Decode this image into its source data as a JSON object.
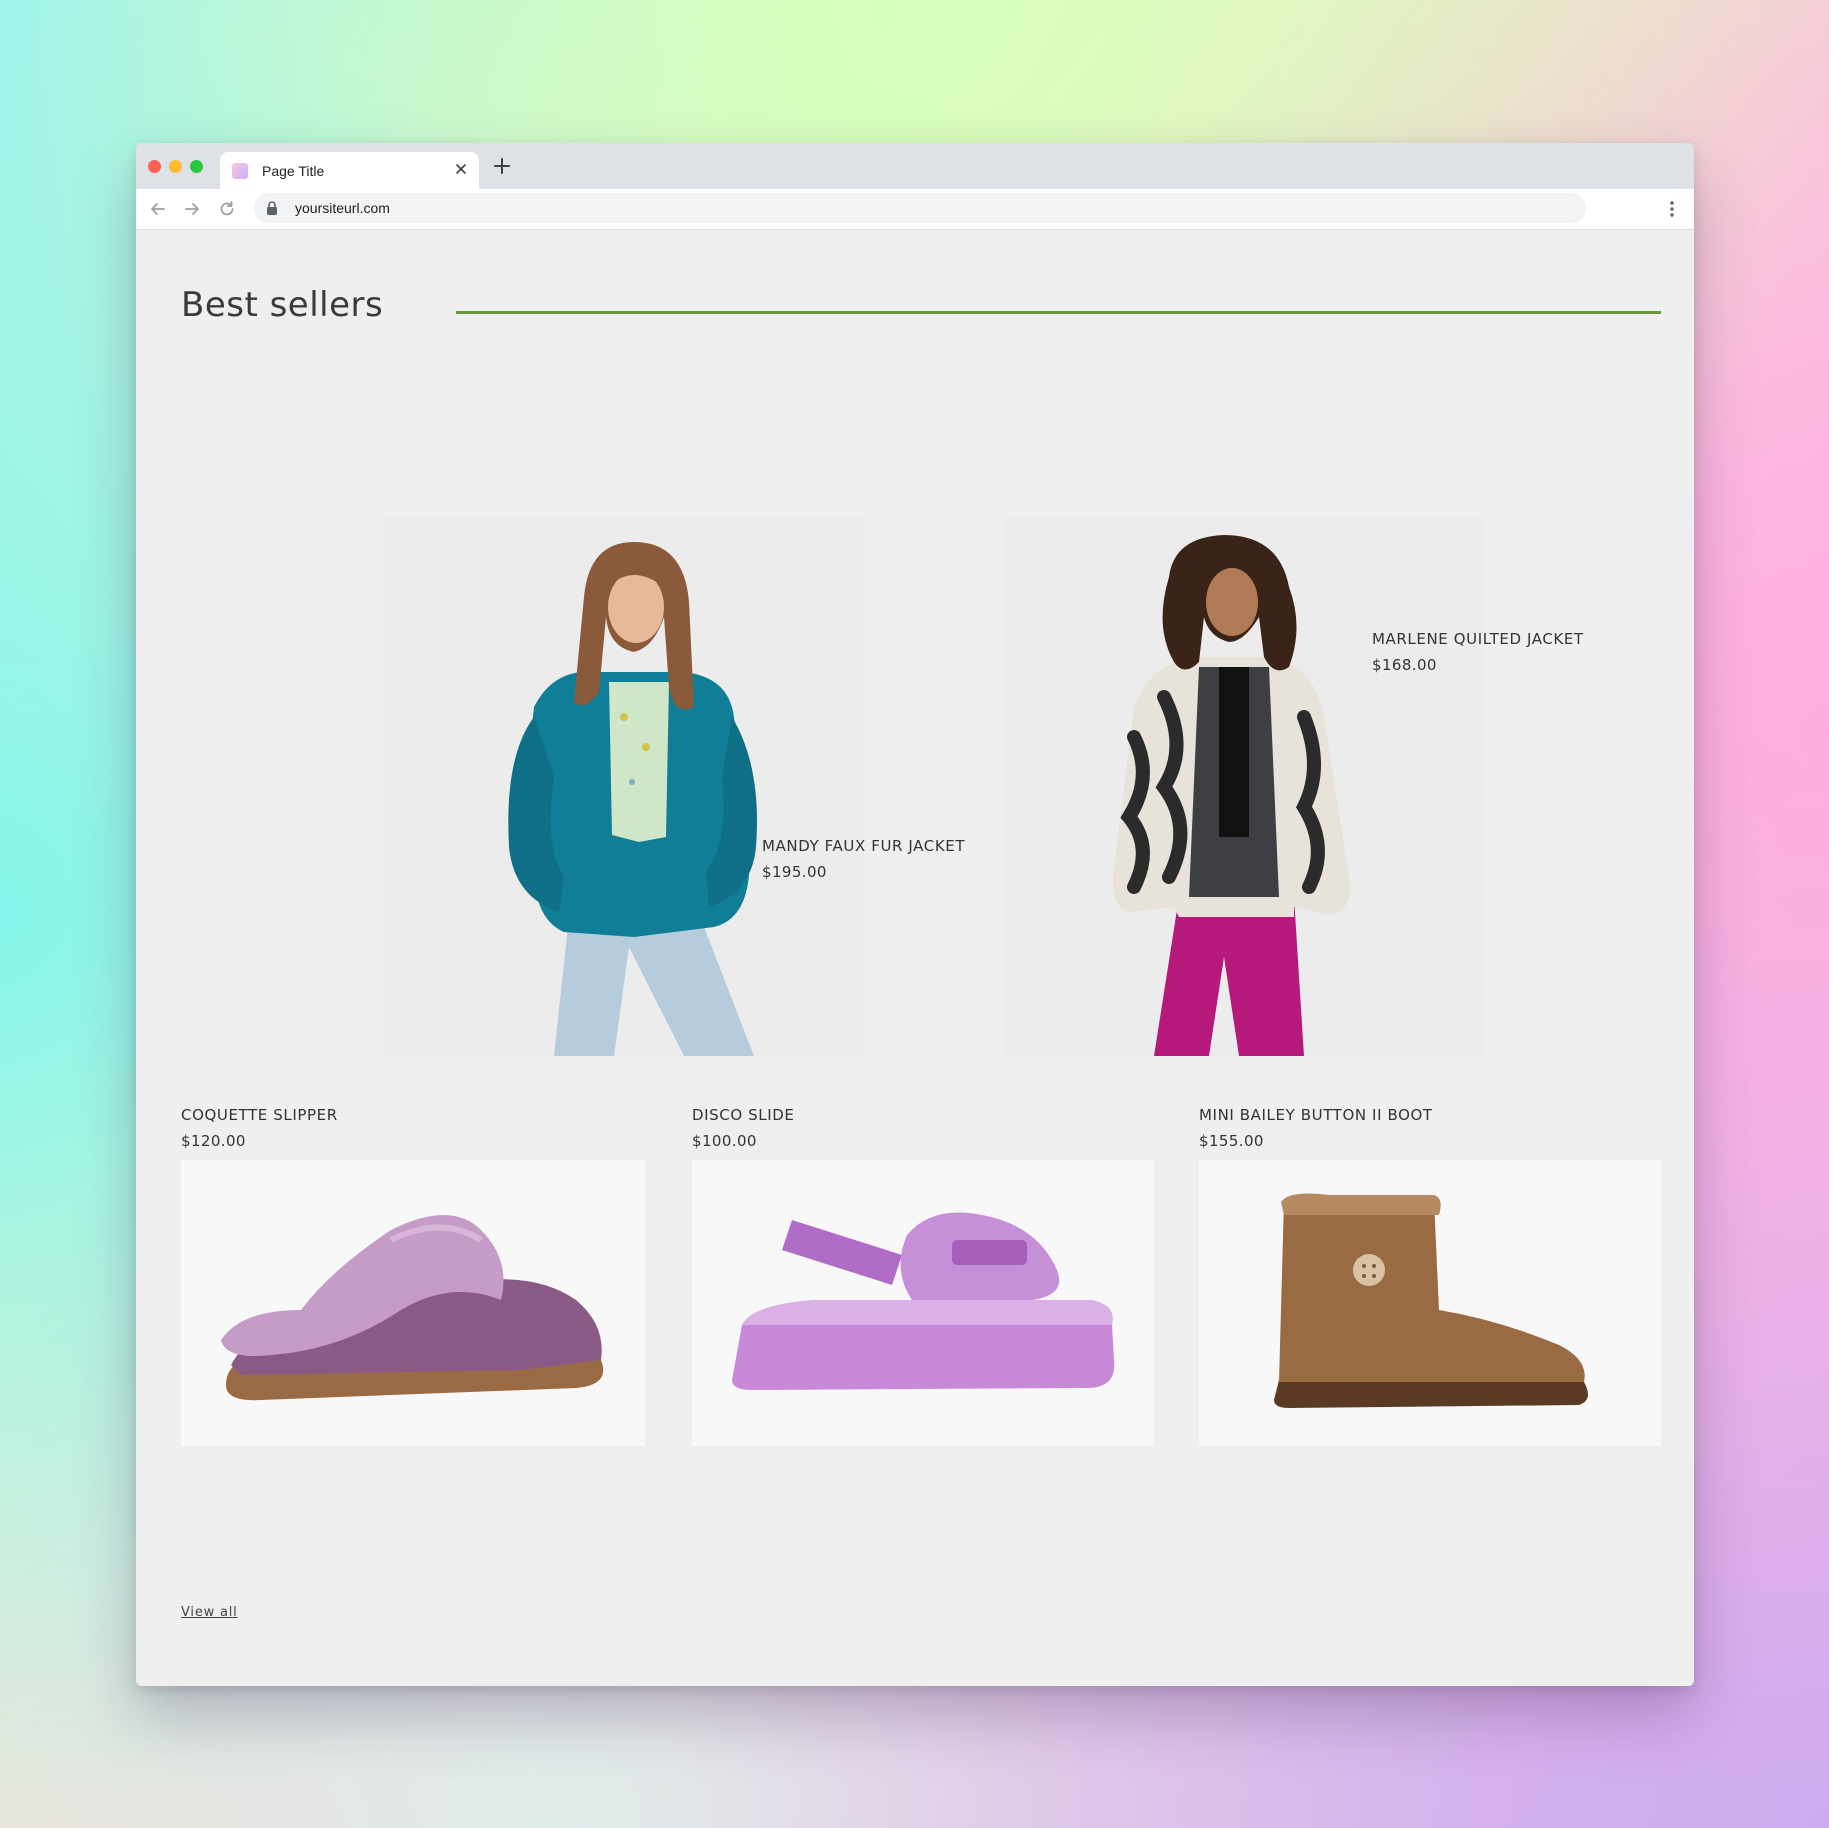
{
  "browser": {
    "tab_title": "Page Title",
    "url": "yoursiteurl.com"
  },
  "section": {
    "title": "Best sellers",
    "accent_color": "#6a9a3a",
    "view_all_label": "View all"
  },
  "featured": [
    {
      "name": "MANDY FAUX FUR JACKET",
      "price": "$195.00"
    },
    {
      "name": "MARLENE QUILTED JACKET",
      "price": "$168.00"
    }
  ],
  "products": [
    {
      "name": "COQUETTE SLIPPER",
      "price": "$120.00"
    },
    {
      "name": "DISCO SLIDE",
      "price": "$100.00"
    },
    {
      "name": "MINI BAILEY BUTTON II BOOT",
      "price": "$155.00"
    }
  ],
  "icons": {
    "back": "arrow-left-icon",
    "forward": "arrow-right-icon",
    "reload": "reload-icon",
    "lock": "lock-icon",
    "menu": "kebab-menu-icon",
    "close": "close-icon",
    "add": "plus-icon"
  }
}
